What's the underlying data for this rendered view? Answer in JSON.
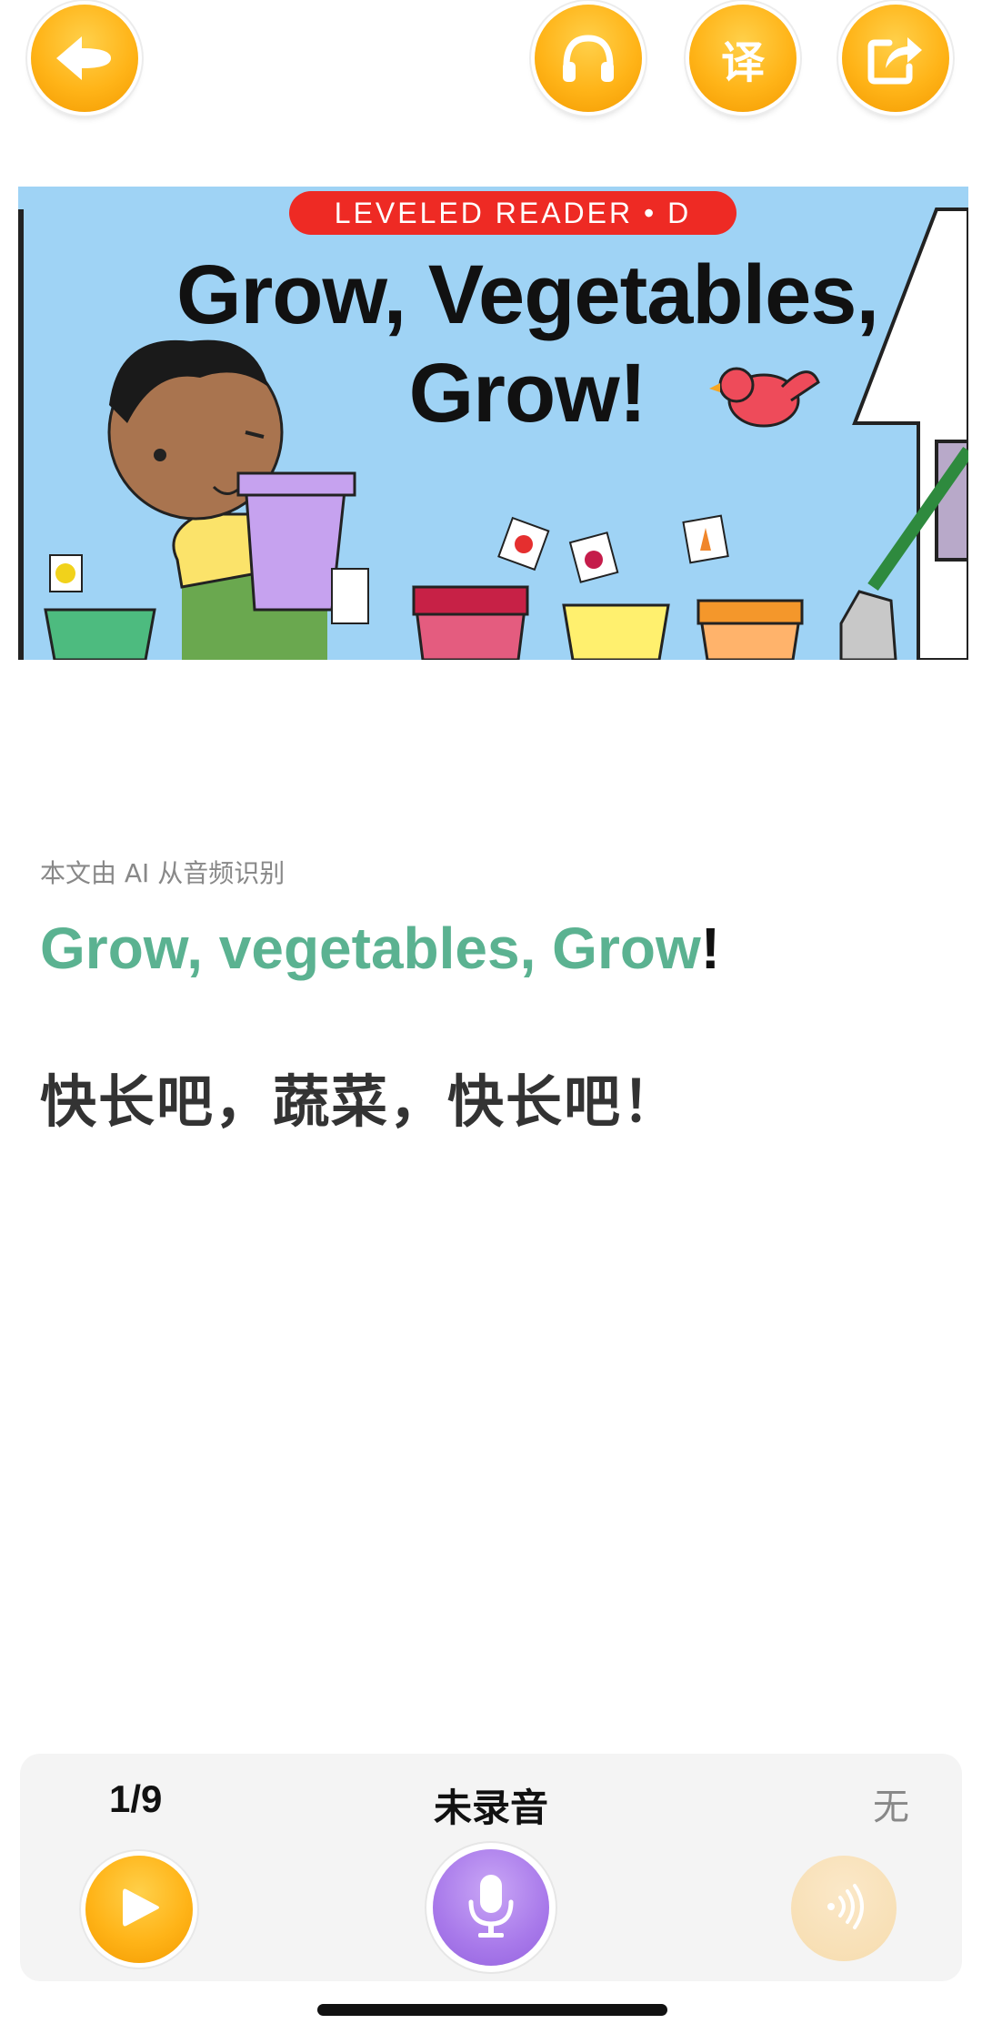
{
  "toolbar": {
    "back_icon": "arrow-left-icon",
    "audio_icon": "headphones-icon",
    "translate_label": "译",
    "share_icon": "share-icon",
    "accent_color": "#ffb418"
  },
  "illustration": {
    "badge_text": "LEVELED READER • D",
    "title_line1": "Grow, Vegetables,",
    "title_line2": "Grow!"
  },
  "content": {
    "ai_note": "本文由 AI 从音频识别",
    "english_highlight": "Grow, vegetables, Grow",
    "english_rest": "!",
    "highlight_color": "#5bb291",
    "chinese": "快长吧，蔬菜，快长吧！"
  },
  "player": {
    "page_counter": "1/9",
    "record_status": "未录音",
    "score_status": "无",
    "play_icon": "play-icon",
    "mic_icon": "microphone-icon",
    "listen_icon": "sound-wave-icon",
    "mic_color": "#a879ea"
  }
}
